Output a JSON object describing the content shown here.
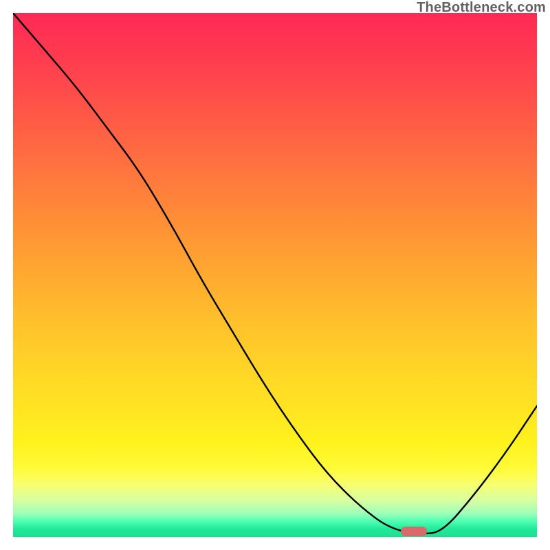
{
  "watermark": "TheBottleneck.com",
  "chart_data": {
    "type": "line",
    "title": "",
    "xlabel": "",
    "ylabel": "",
    "xlim": [
      0,
      1
    ],
    "ylim": [
      0,
      1
    ],
    "x": [
      0.0,
      0.06,
      0.12,
      0.18,
      0.24,
      0.3,
      0.36,
      0.42,
      0.48,
      0.54,
      0.6,
      0.66,
      0.72,
      0.78,
      0.82,
      0.88,
      0.94,
      1.0
    ],
    "values": [
      1.0,
      0.93,
      0.86,
      0.78,
      0.7,
      0.6,
      0.49,
      0.39,
      0.29,
      0.2,
      0.12,
      0.06,
      0.015,
      0.005,
      0.01,
      0.08,
      0.16,
      0.25
    ],
    "marker_band": {
      "x_start": 0.74,
      "x_end": 0.79,
      "y": 0.005
    }
  }
}
